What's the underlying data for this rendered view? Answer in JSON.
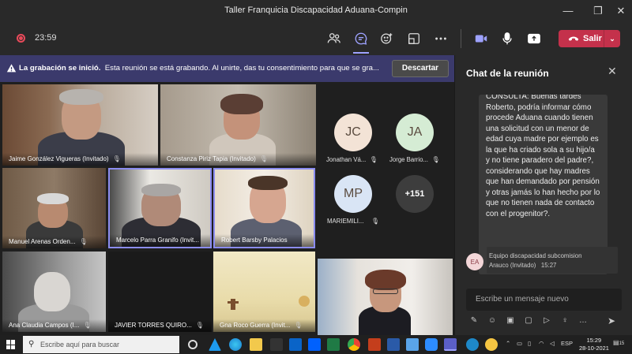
{
  "window": {
    "title": "Taller Franquicia Discapacidad Aduana-Compin",
    "minimize": "—",
    "maximize": "❐",
    "close": "✕"
  },
  "toolbar": {
    "timer": "23:59",
    "leave_label": "Salir"
  },
  "banner": {
    "bold": "La grabación se inició.",
    "text": "Esta reunión se está grabando. Al unirte, das tu consentimiento para que se gra...",
    "dismiss_label": "Descartar"
  },
  "tiles": [
    {
      "name": "Jaime González Vigueras (Invitado)"
    },
    {
      "name": "Constanza Piriz Tapia (Invitado)"
    },
    {
      "name": "Manuel Arenas Orden..."
    },
    {
      "name": "Marcelo Parra Granifo (Invit..."
    },
    {
      "name": "Robert Barsby Palacios"
    },
    {
      "name": "Ana Claudia Campos (I..."
    },
    {
      "name": "JAVIER TORRES QUIRO..."
    },
    {
      "name": "Gna Roco Guerra (Invit..."
    },
    {
      "name": ""
    }
  ],
  "avatars": [
    {
      "initials": "JC",
      "label": "Jonathan Vá...",
      "color": "#f3e3d6"
    },
    {
      "initials": "JA",
      "label": "Jorge Barrio...",
      "color": "#d5ecd4"
    },
    {
      "initials": "MP",
      "label": "MARIEMILI...",
      "color": "#d9e5f5"
    }
  ],
  "overflow": {
    "label": "+151"
  },
  "chat": {
    "title": "Chat de la reunión",
    "message_text": "CONSULTA: Buenas tardes Roberto, podría informar cómo procede Aduana cuando tienen una solicitud con un menor de edad cuya madre por ejemplo es la que ha criado sola a su hijo/a y no tiene paradero del padre?, considerando que hay madres que han demandado por pensión y otras jamás lo han hecho por lo que no tienen nada de contacto con el progenitor?.",
    "next_sender_initials": "EA",
    "next_sender": "Equipo discapacidad subcomision",
    "next_sender_line2": "Arauco (Invitado)",
    "next_time": "15:27",
    "compose_placeholder": "Escribe un mensaje nuevo"
  },
  "taskbar": {
    "search_placeholder": "Escribe aquí para buscar",
    "lang": "ESP",
    "time": "15:29",
    "date": "28-10-2021",
    "notifications": "15"
  }
}
